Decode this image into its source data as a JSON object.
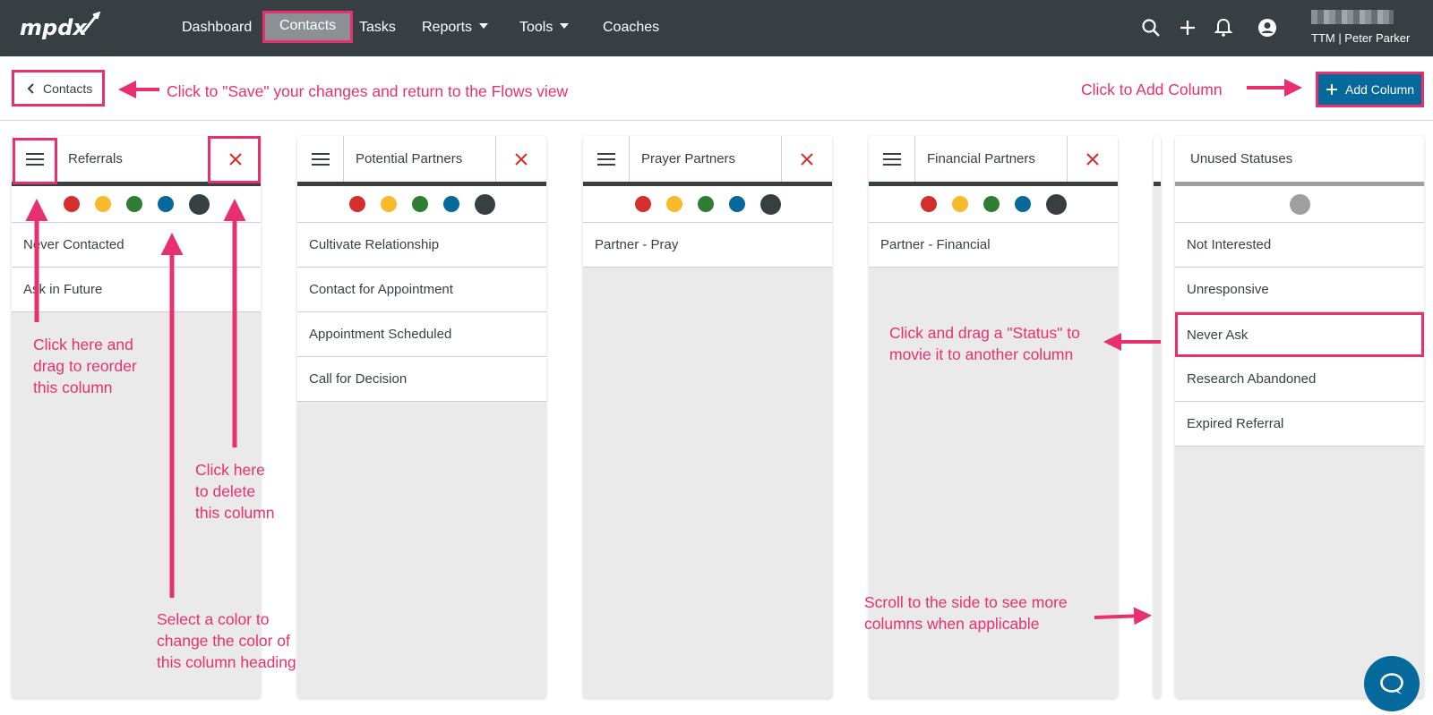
{
  "nav": {
    "logo_text": "mpdx",
    "items": [
      {
        "label": "Dashboard"
      },
      {
        "label": "Contacts"
      },
      {
        "label": "Tasks"
      },
      {
        "label": "Reports"
      },
      {
        "label": "Tools"
      },
      {
        "label": "Coaches"
      }
    ],
    "user": "TTM | Peter Parker"
  },
  "toolbar": {
    "back_label": "Contacts",
    "add_column_label": "Add Column"
  },
  "annotations": {
    "save": "Click to \"Save\" your changes and return to the Flows view",
    "add_column": "Click to Add Column",
    "reorder": "Click here and\ndrag to reorder\nthis column",
    "delete": "Click here\nto delete\nthis column",
    "color": "Select a color to\nchange the color of\nthis column heading",
    "drag_status": "Click and drag a \"Status\" to\nmovie it to another column",
    "scroll": "Scroll to the side to see more\ncolumns when applicable"
  },
  "columns": [
    {
      "title": "Referrals",
      "statuses": [
        "Never Contacted",
        "Ask in Future"
      ]
    },
    {
      "title": "Potential Partners",
      "statuses": [
        "Cultivate Relationship",
        "Contact for Appointment",
        "Appointment Scheduled",
        "Call for Decision"
      ]
    },
    {
      "title": "Prayer Partners",
      "statuses": [
        "Partner - Pray"
      ]
    },
    {
      "title": "Financial Partners",
      "statuses": [
        "Partner - Financial"
      ]
    },
    {
      "title": "Unused Statuses",
      "statuses": [
        "Not Interested",
        "Unresponsive",
        "Never Ask",
        "Research Abandoned",
        "Expired Referral"
      ]
    }
  ],
  "colors": {
    "accent": "#e8306f",
    "primary": "#05699b",
    "nav_bg": "#383f43",
    "swatches": [
      "#d32f2f",
      "#f8b92b",
      "#2e7d32",
      "#05699b",
      "#383f43"
    ],
    "unused_swatch": "#9f9f9f"
  }
}
